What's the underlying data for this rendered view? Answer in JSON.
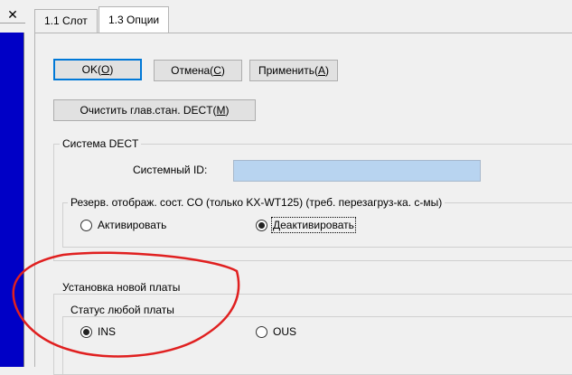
{
  "window": {
    "close_glyph": "✕"
  },
  "tabs": [
    {
      "label": "1.1 Слот",
      "active": false
    },
    {
      "label": "1.3 Опции",
      "active": true
    }
  ],
  "buttons": {
    "ok": {
      "label": "OK(",
      "mnemonic": "O",
      "suffix": ")"
    },
    "cancel": {
      "label": "Отмена(",
      "mnemonic": "C",
      "suffix": ")"
    },
    "apply": {
      "label": "Применить(",
      "mnemonic": "A",
      "suffix": ")"
    },
    "clear": {
      "label": "Очистить глав.стан. DECT(",
      "mnemonic": "M",
      "suffix": ")"
    }
  },
  "dect": {
    "group_title": "Система DECT",
    "system_id_label": "Системный ID:",
    "system_id_value": "",
    "reserve_group_title": "Резерв. отображ. сост. CO (только KX-WT125) (треб. перезагруз-ка. с-мы)",
    "radio_activate": "Активировать",
    "radio_deactivate": "Деактивировать",
    "selected": "deactivate"
  },
  "new_board": {
    "group_title": "Установка новой платы",
    "status_group_title": "Статус любой платы",
    "radio_ins": "INS",
    "radio_ous": "OUS",
    "selected": "ins"
  },
  "colors": {
    "left_pane": "#0000c6",
    "annotation_red": "#e02020",
    "field_fill": "#b8d4f0",
    "default_button_border": "#0078d7"
  }
}
